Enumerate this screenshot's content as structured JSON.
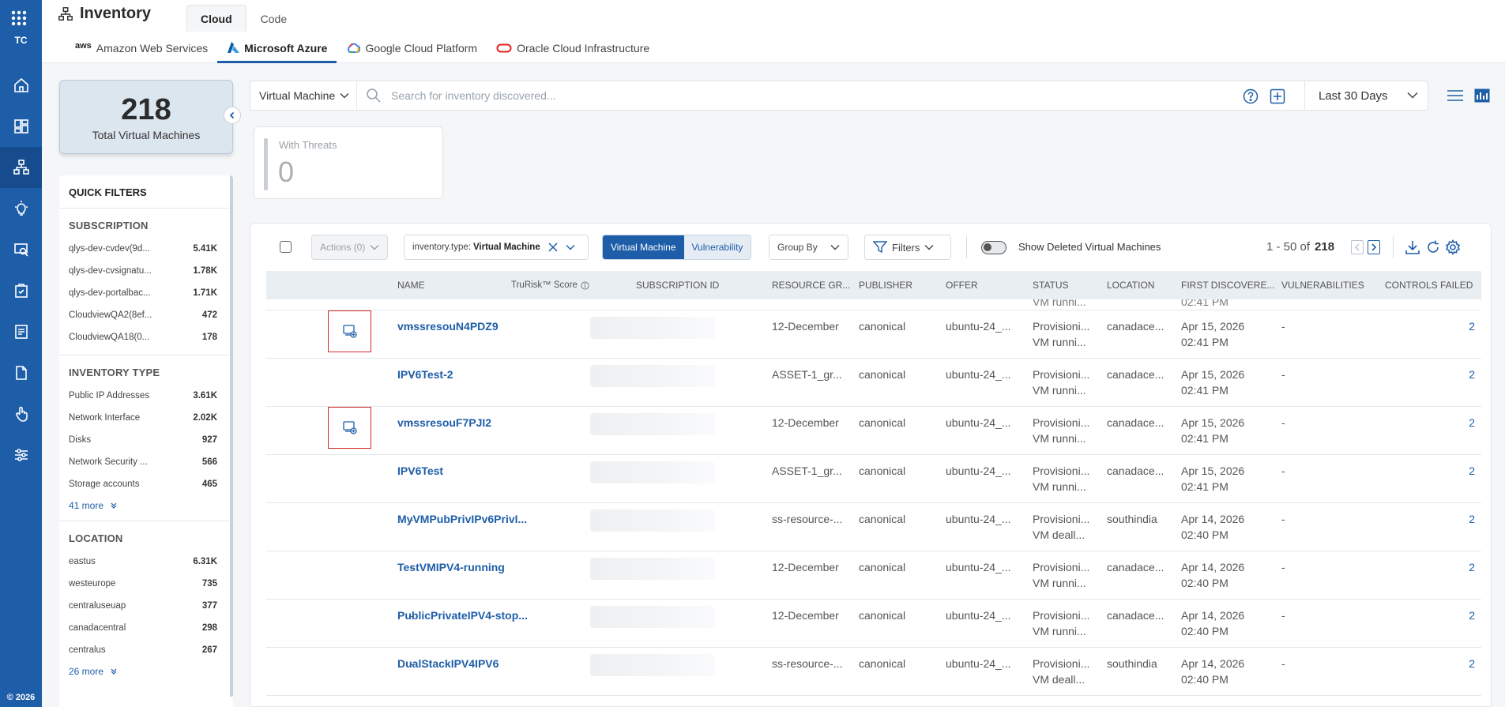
{
  "rail": {
    "org": "TC",
    "copyright": "© 2026",
    "items": [
      "home-icon",
      "dashboard-icon",
      "inventory-icon",
      "insights-icon",
      "asset-search-icon",
      "security-icon",
      "reports-icon",
      "document-icon",
      "touch-icon",
      "settings-sliders-icon"
    ]
  },
  "header": {
    "title": "Inventory",
    "tabs": [
      "Cloud",
      "Code"
    ],
    "providers": [
      {
        "label": "Amazon Web Services",
        "badge": "aws"
      },
      {
        "label": "Microsoft Azure"
      },
      {
        "label": "Google Cloud Platform"
      },
      {
        "label": "Oracle Cloud Infrastructure"
      }
    ]
  },
  "summary": {
    "count": "218",
    "label": "Total Virtual Machines"
  },
  "quick_filters": {
    "title": "QUICK FILTERS",
    "subscription": {
      "heading": "SUBSCRIPTION",
      "items": [
        {
          "label": "qlys-dev-cvdev(9d...",
          "value": "5.41K"
        },
        {
          "label": "qlys-dev-cvsignatu...",
          "value": "1.78K"
        },
        {
          "label": "qlys-dev-portalbac...",
          "value": "1.71K"
        },
        {
          "label": "CloudviewQA2(8ef...",
          "value": "472"
        },
        {
          "label": "CloudviewQA18(0...",
          "value": "178"
        }
      ]
    },
    "inventory_type": {
      "heading": "INVENTORY TYPE",
      "items": [
        {
          "label": "Public IP Addresses",
          "value": "3.61K"
        },
        {
          "label": "Network Interface",
          "value": "2.02K"
        },
        {
          "label": "Disks",
          "value": "927"
        },
        {
          "label": "Network Security ...",
          "value": "566"
        },
        {
          "label": "Storage accounts",
          "value": "465"
        }
      ],
      "more": "41 more"
    },
    "location": {
      "heading": "LOCATION",
      "items": [
        {
          "label": "eastus",
          "value": "6.31K"
        },
        {
          "label": "westeurope",
          "value": "735"
        },
        {
          "label": "centraluseuap",
          "value": "377"
        },
        {
          "label": "canadacentral",
          "value": "298"
        },
        {
          "label": "centralus",
          "value": "267"
        }
      ],
      "more": "26 more"
    }
  },
  "search": {
    "type": "Virtual Machine",
    "placeholder": "Search for inventory discovered...",
    "range": "Last 30 Days"
  },
  "threats": {
    "label": "With Threats",
    "value": "0"
  },
  "toolbar": {
    "actions": "Actions (0)",
    "chip_key": "inventory.type:",
    "chip_value": "Virtual Machine",
    "seg_on": "Virtual Machine",
    "seg_off": "Vulnerability",
    "group_by": "Group By",
    "filters": "Filters",
    "show_deleted": "Show Deleted Virtual Machines",
    "range": "1 - 50 of",
    "total": "218"
  },
  "table": {
    "headers": [
      "NAME",
      "TruRisk™ Score",
      "SUBSCRIPTION ID",
      "RESOURCE GR...",
      "PUBLISHER",
      "OFFER",
      "STATUS",
      "LOCATION",
      "FIRST DISCOVERE...",
      "VULNERABILITIES",
      "CONTROLS FAILED"
    ],
    "partial_row": {
      "status": "VM runni...",
      "date": "02:41 PM"
    },
    "rows": [
      {
        "icon": true,
        "name": "vmssresouN4PDZ9",
        "trurisk": "-",
        "rg": "12-December",
        "publisher": "canonical",
        "offer": "ubuntu-24_...",
        "status1": "Provisioni...",
        "status2": "VM runni...",
        "location": "canadace...",
        "date1": "Apr 15, 2026",
        "date2": "02:41 PM",
        "vulns": "-",
        "controls": "2"
      },
      {
        "icon": false,
        "name": "IPV6Test-2",
        "trurisk": "-",
        "rg": "ASSET-1_gr...",
        "publisher": "canonical",
        "offer": "ubuntu-24_...",
        "status1": "Provisioni...",
        "status2": "VM runni...",
        "location": "canadace...",
        "date1": "Apr 15, 2026",
        "date2": "02:41 PM",
        "vulns": "-",
        "controls": "2"
      },
      {
        "icon": true,
        "name": "vmssresouF7PJI2",
        "trurisk": "-",
        "rg": "12-December",
        "publisher": "canonical",
        "offer": "ubuntu-24_...",
        "status1": "Provisioni...",
        "status2": "VM runni...",
        "location": "canadace...",
        "date1": "Apr 15, 2026",
        "date2": "02:41 PM",
        "vulns": "-",
        "controls": "2"
      },
      {
        "icon": false,
        "name": "IPV6Test",
        "trurisk": "-",
        "rg": "ASSET-1_gr...",
        "publisher": "canonical",
        "offer": "ubuntu-24_...",
        "status1": "Provisioni...",
        "status2": "VM runni...",
        "location": "canadace...",
        "date1": "Apr 15, 2026",
        "date2": "02:41 PM",
        "vulns": "-",
        "controls": "2"
      },
      {
        "icon": false,
        "name": "MyVMPubPrivIPv6PrivI...",
        "trurisk": "-",
        "rg": "ss-resource-...",
        "publisher": "canonical",
        "offer": "ubuntu-24_...",
        "status1": "Provisioni...",
        "status2": "VM deall...",
        "location": "southindia",
        "date1": "Apr 14, 2026",
        "date2": "02:40 PM",
        "vulns": "-",
        "controls": "2"
      },
      {
        "icon": false,
        "name": "TestVMIPV4-running",
        "trurisk": "-",
        "rg": "12-December",
        "publisher": "canonical",
        "offer": "ubuntu-24_...",
        "status1": "Provisioni...",
        "status2": "VM runni...",
        "location": "canadace...",
        "date1": "Apr 14, 2026",
        "date2": "02:40 PM",
        "vulns": "-",
        "controls": "2"
      },
      {
        "icon": false,
        "name": "PublicPrivateIPV4-stop...",
        "trurisk": "-",
        "rg": "12-December",
        "publisher": "canonical",
        "offer": "ubuntu-24_...",
        "status1": "Provisioni...",
        "status2": "VM runni...",
        "location": "canadace...",
        "date1": "Apr 14, 2026",
        "date2": "02:40 PM",
        "vulns": "-",
        "controls": "2"
      },
      {
        "icon": false,
        "name": "DualStackIPV4IPV6",
        "trurisk": "-",
        "rg": "ss-resource-...",
        "publisher": "canonical",
        "offer": "ubuntu-24_...",
        "status1": "Provisioni...",
        "status2": "VM deall...",
        "location": "southindia",
        "date1": "Apr 14, 2026",
        "date2": "02:40 PM",
        "vulns": "-",
        "controls": "2"
      }
    ]
  },
  "colors": {
    "brand": "#1e5ea9",
    "highlight": "#d12b2b"
  }
}
